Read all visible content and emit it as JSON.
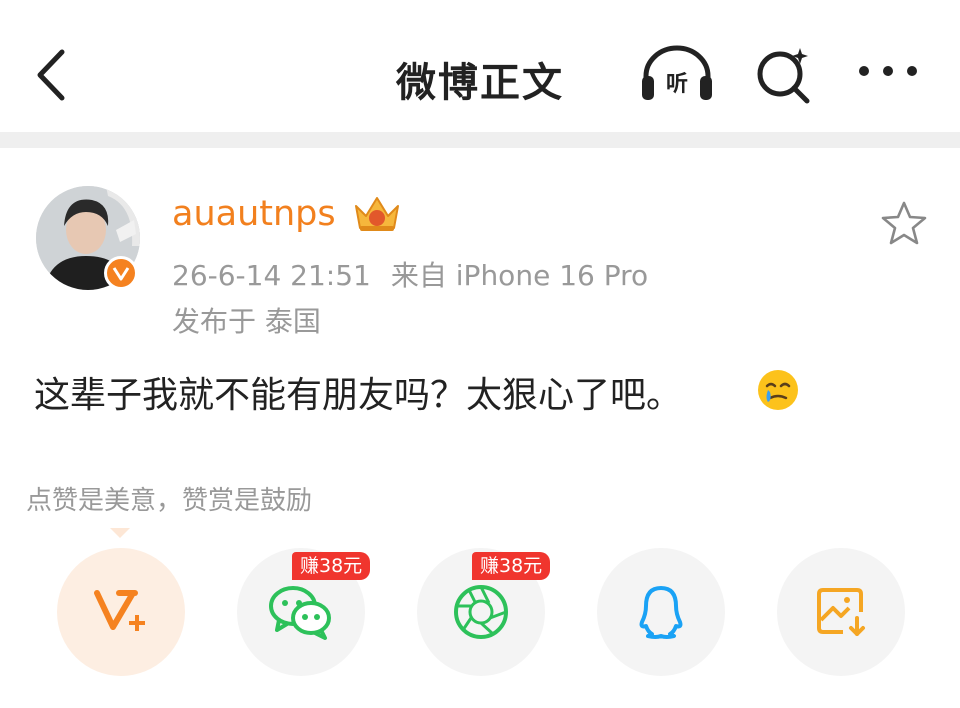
{
  "header": {
    "title": "微博正文"
  },
  "post": {
    "username": "auautnps",
    "timestamp": "26-6-14 21:51",
    "source": "来自 iPhone 16 Pro",
    "location": "发布于 泰国",
    "content": "这辈子我就不能有朋友吗？太狠心了吧。"
  },
  "reward": {
    "text": "点赞是美意，赞赏是鼓励"
  },
  "share": {
    "wechat_badge": "赚38元",
    "moments_badge": "赚38元"
  },
  "colors": {
    "accent": "#f2801e",
    "wechat": "#2dc15a",
    "qq": "#1aa2f5",
    "badge": "#f0352e"
  },
  "icons": [
    "back-icon",
    "listen-icon",
    "search-icon",
    "more-icon",
    "crown-icon",
    "star-icon",
    "verified-icon",
    "tear-emoji",
    "reward-v-icon",
    "wechat-icon",
    "moments-icon",
    "qq-icon",
    "save-image-icon"
  ]
}
